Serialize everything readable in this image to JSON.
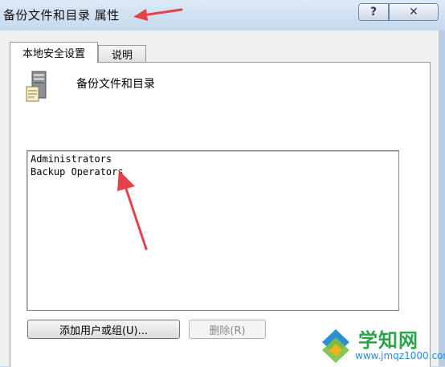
{
  "window": {
    "title": "备份文件和目录 属性",
    "help_label": "?",
    "close_label": "✕"
  },
  "tabs": [
    {
      "label": "本地安全设置",
      "active": true
    },
    {
      "label": "说明",
      "active": false
    }
  ],
  "policy": {
    "name": "备份文件和目录",
    "icon": "server-icon"
  },
  "members": [
    "Administrators",
    "Backup Operators"
  ],
  "buttons": {
    "add_label": "添加用户或组(U)...",
    "remove_label": "删除(R)",
    "remove_enabled": false
  },
  "annotations": {
    "arrow_color": "#e8404a"
  },
  "watermark": {
    "site_cn": "学知网",
    "site_url": "www.jmqz1000.com"
  }
}
